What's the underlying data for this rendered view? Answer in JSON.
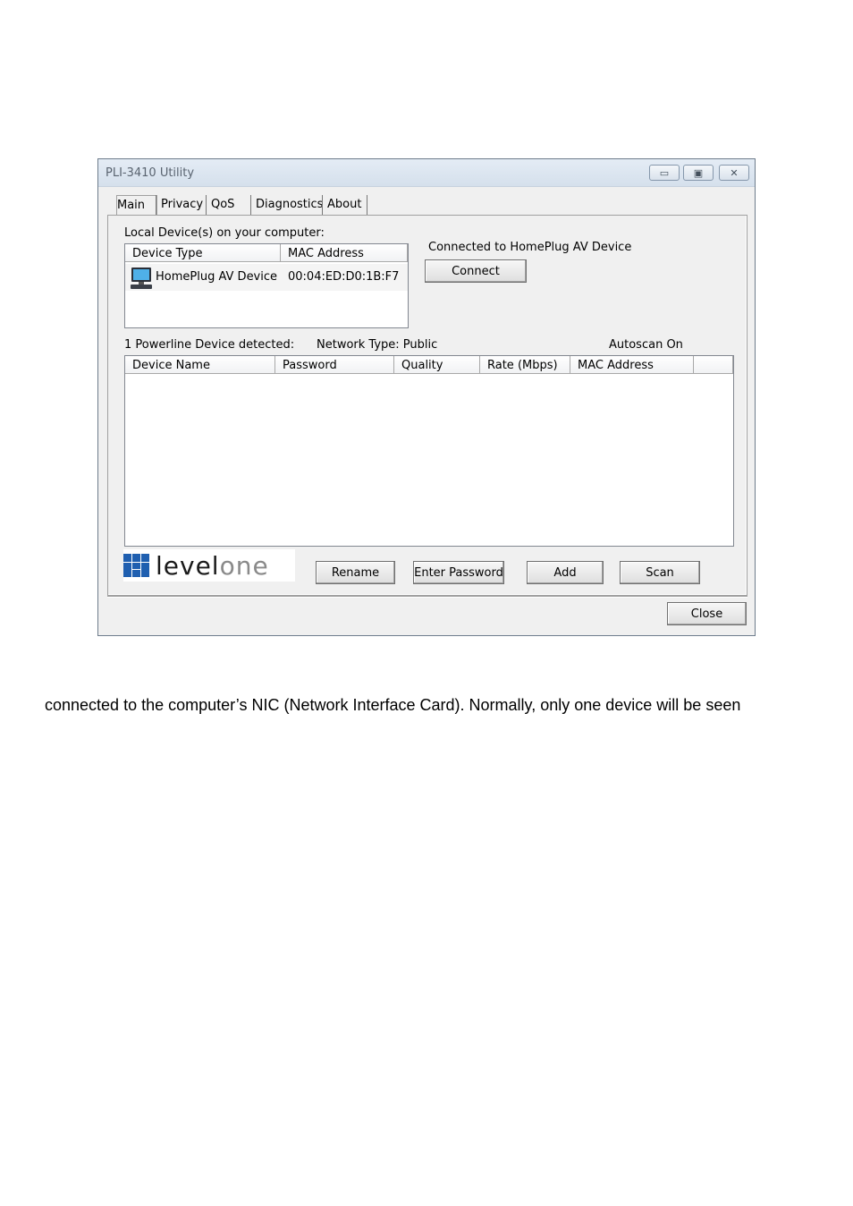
{
  "window": {
    "title": "PLI-3410 Utility",
    "controls": {
      "minimize": "▭",
      "maximize": "▣",
      "close": "✕"
    }
  },
  "tabs": [
    {
      "label": "Main"
    },
    {
      "label": "Privacy"
    },
    {
      "label": "QoS"
    },
    {
      "label": "Diagnostics"
    },
    {
      "label": "About"
    }
  ],
  "local": {
    "heading": "Local Device(s) on your computer:",
    "columns": [
      "Device Type",
      "MAC Address"
    ],
    "rows": [
      {
        "device_type": "HomePlug AV Device",
        "mac": "00:04:ED:D0:1B:F7"
      }
    ]
  },
  "connected": {
    "label": "Connected to HomePlug AV Device",
    "connect_button": "Connect"
  },
  "status": {
    "detected": "1 Powerline Device detected:",
    "network_type": "Network Type: Public",
    "autoscan": "Autoscan On"
  },
  "remote": {
    "columns": [
      "Device Name",
      "Password",
      "Quality",
      "Rate (Mbps)",
      "MAC Address",
      ""
    ]
  },
  "logo": {
    "part1": "level",
    "part2": "one"
  },
  "buttons": {
    "rename": "Rename",
    "enter_password": "Enter Password",
    "add": "Add",
    "scan": "Scan",
    "close": "Close"
  },
  "caption": "connected to the computer’s NIC (Network Interface Card). Normally, only one device will be seen"
}
